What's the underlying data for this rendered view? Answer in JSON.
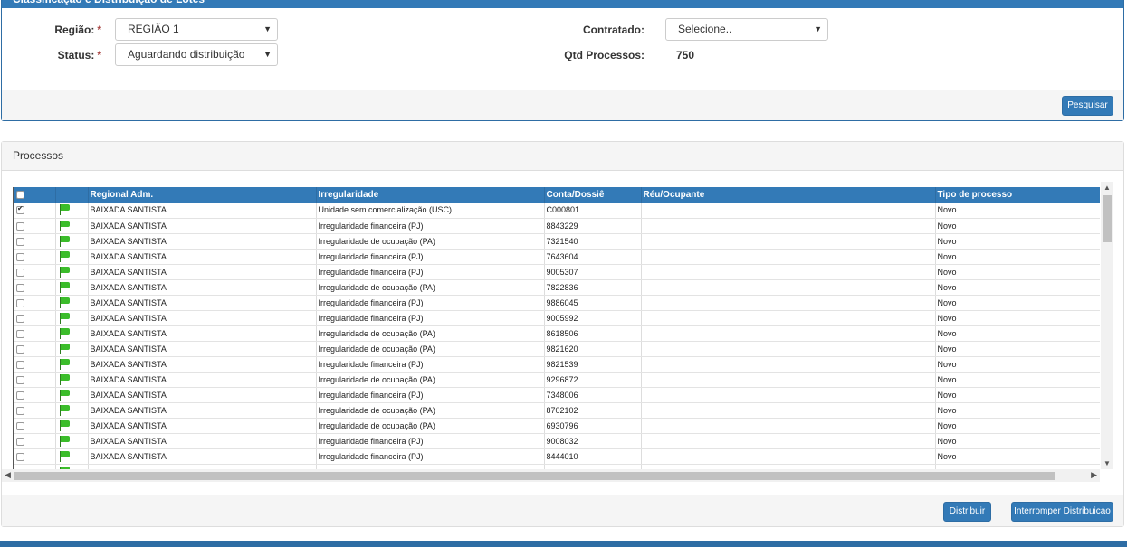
{
  "filter": {
    "title": "Classificação e Distribuição de Lotes",
    "regiao_label": "Região:",
    "status_label": "Status:",
    "required_mark": "*",
    "regiao_value": "REGIÃO 1",
    "status_value": "Aguardando distribuição",
    "contratado_label": "Contratado:",
    "contratado_value": "Selecione..",
    "qtd_label": "Qtd Processos:",
    "qtd_value": "750",
    "search_button": "Pesquisar"
  },
  "processos": {
    "title": "Processos",
    "columns": [
      "",
      "",
      "Regional Adm.",
      "Irregularidade",
      "Conta/Dossiê",
      "Réu/Ocupante",
      "Tipo de processo"
    ],
    "rows": [
      {
        "checked": true,
        "regional": "BAIXADA SANTISTA",
        "irregularidade": "Unidade sem comercialização (USC)",
        "conta": "C000801",
        "reu": "",
        "tipo": "Novo"
      },
      {
        "checked": false,
        "regional": "BAIXADA SANTISTA",
        "irregularidade": "Irregularidade financeira (PJ)",
        "conta": "8843229",
        "reu": "",
        "tipo": "Novo"
      },
      {
        "checked": false,
        "regional": "BAIXADA SANTISTA",
        "irregularidade": "Irregularidade de ocupação (PA)",
        "conta": "7321540",
        "reu": "",
        "tipo": "Novo"
      },
      {
        "checked": false,
        "regional": "BAIXADA SANTISTA",
        "irregularidade": "Irregularidade financeira (PJ)",
        "conta": "7643604",
        "reu": "",
        "tipo": "Novo"
      },
      {
        "checked": false,
        "regional": "BAIXADA SANTISTA",
        "irregularidade": "Irregularidade financeira (PJ)",
        "conta": "9005307",
        "reu": "",
        "tipo": "Novo"
      },
      {
        "checked": false,
        "regional": "BAIXADA SANTISTA",
        "irregularidade": "Irregularidade de ocupação (PA)",
        "conta": "7822836",
        "reu": "",
        "tipo": "Novo"
      },
      {
        "checked": false,
        "regional": "BAIXADA SANTISTA",
        "irregularidade": "Irregularidade financeira (PJ)",
        "conta": "9886045",
        "reu": "",
        "tipo": "Novo"
      },
      {
        "checked": false,
        "regional": "BAIXADA SANTISTA",
        "irregularidade": "Irregularidade financeira (PJ)",
        "conta": "9005992",
        "reu": "",
        "tipo": "Novo"
      },
      {
        "checked": false,
        "regional": "BAIXADA SANTISTA",
        "irregularidade": "Irregularidade de ocupação (PA)",
        "conta": "8618506",
        "reu": "",
        "tipo": "Novo"
      },
      {
        "checked": false,
        "regional": "BAIXADA SANTISTA",
        "irregularidade": "Irregularidade de ocupação (PA)",
        "conta": "9821620",
        "reu": "",
        "tipo": "Novo"
      },
      {
        "checked": false,
        "regional": "BAIXADA SANTISTA",
        "irregularidade": "Irregularidade financeira (PJ)",
        "conta": "9821539",
        "reu": "",
        "tipo": "Novo"
      },
      {
        "checked": false,
        "regional": "BAIXADA SANTISTA",
        "irregularidade": "Irregularidade de ocupação (PA)",
        "conta": "9296872",
        "reu": "",
        "tipo": "Novo"
      },
      {
        "checked": false,
        "regional": "BAIXADA SANTISTA",
        "irregularidade": "Irregularidade financeira (PJ)",
        "conta": "7348006",
        "reu": "",
        "tipo": "Novo"
      },
      {
        "checked": false,
        "regional": "BAIXADA SANTISTA",
        "irregularidade": "Irregularidade de ocupação (PA)",
        "conta": "8702102",
        "reu": "",
        "tipo": "Novo"
      },
      {
        "checked": false,
        "regional": "BAIXADA SANTISTA",
        "irregularidade": "Irregularidade de ocupação (PA)",
        "conta": "6930796",
        "reu": "",
        "tipo": "Novo"
      },
      {
        "checked": false,
        "regional": "BAIXADA SANTISTA",
        "irregularidade": "Irregularidade financeira (PJ)",
        "conta": "9008032",
        "reu": "",
        "tipo": "Novo"
      },
      {
        "checked": false,
        "regional": "BAIXADA SANTISTA",
        "irregularidade": "Irregularidade financeira (PJ)",
        "conta": "8444010",
        "reu": "",
        "tipo": "Novo"
      },
      {
        "checked": false,
        "regional": "",
        "irregularidade": "",
        "conta": "",
        "reu": "",
        "tipo": ""
      }
    ],
    "distribuir_button": "Distribuir",
    "interromper_button": "Interromper Distribuicao"
  },
  "colors": {
    "header_blue": "#337ab7",
    "flag_green": "#3bbd2a"
  }
}
